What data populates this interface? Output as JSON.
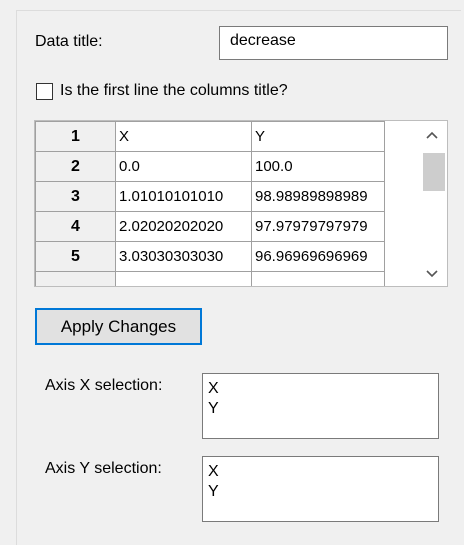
{
  "data_title": {
    "label": "Data title:",
    "value": "decrease"
  },
  "first_line_checkbox": {
    "label": "Is the first line the columns title?",
    "checked": false
  },
  "table": {
    "rows": [
      {
        "num": "1",
        "x": "X",
        "y": "Y"
      },
      {
        "num": "2",
        "x": "0.0",
        "y": "100.0"
      },
      {
        "num": "3",
        "x": "1.01010101010",
        "y": "98.98989898989"
      },
      {
        "num": "4",
        "x": "2.02020202020",
        "y": "97.97979797979"
      },
      {
        "num": "5",
        "x": "3.03030303030",
        "y": "96.96969696969"
      },
      {
        "num": "",
        "x": "",
        "y": ""
      }
    ]
  },
  "scrollbar": {
    "up_icon": "chevron-up-icon",
    "down_icon": "chevron-down-icon"
  },
  "apply_button": {
    "label": "Apply Changes"
  },
  "axis_x": {
    "label": "Axis X selection:",
    "options": [
      "X",
      "Y"
    ]
  },
  "axis_y": {
    "label": "Axis Y selection:",
    "options": [
      "X",
      "Y"
    ]
  },
  "colors": {
    "accent": "#0078d7",
    "background": "#f0f0f0"
  }
}
